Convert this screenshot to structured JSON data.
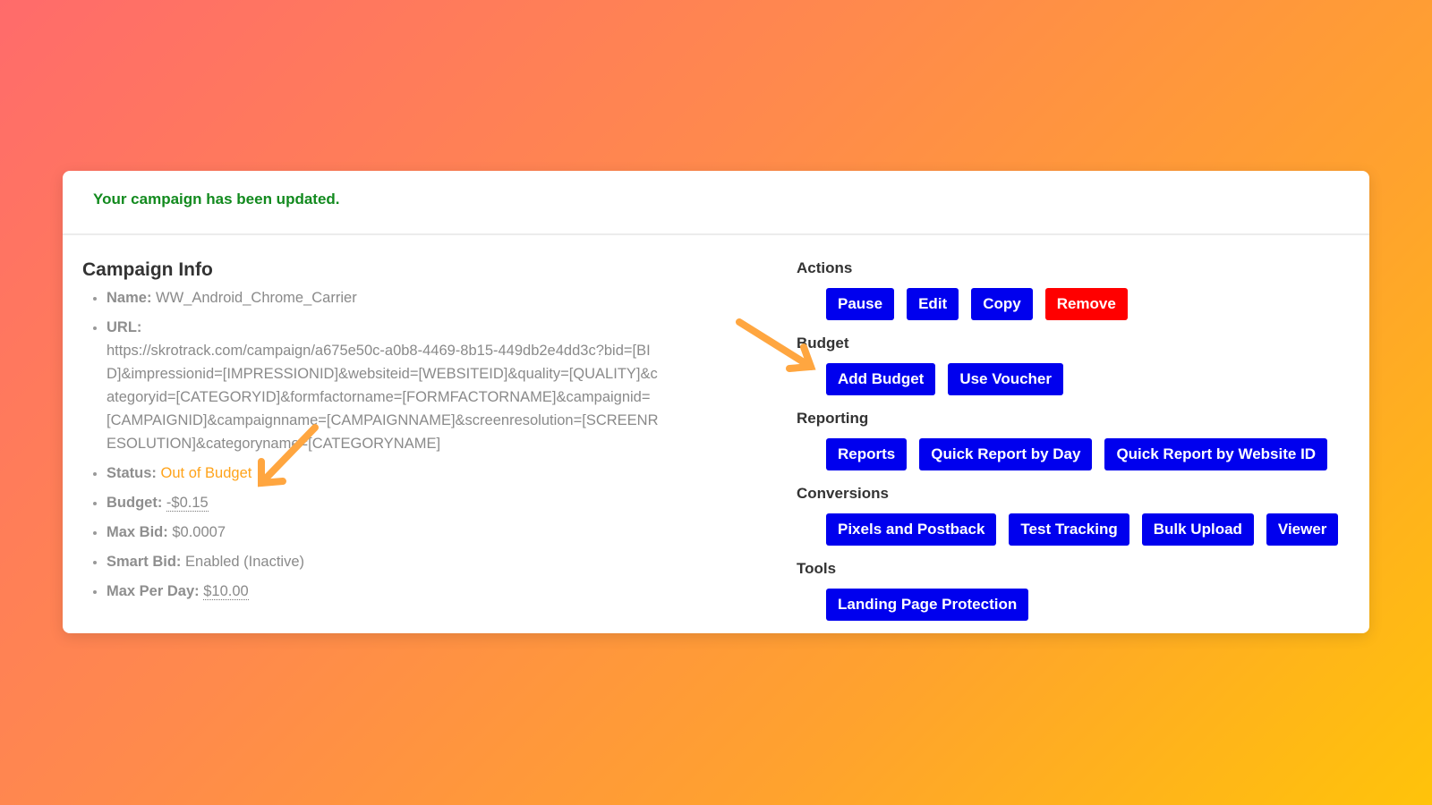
{
  "alert": {
    "message": "Your campaign has been updated.",
    "color": "#128a1e"
  },
  "campaign_info": {
    "title": "Campaign Info",
    "name_label": "Name:",
    "name_value": "WW_Android_Chrome_Carrier",
    "url_label": "URL:",
    "url_value": "https://skrotrack.com/campaign/a675e50c-a0b8-4469-8b15-449db2e4dd3c?bid=[BID]&impressionid=[IMPRESSIONID]&websiteid=[WEBSITEID]&quality=[QUALITY]&categoryid=[CATEGORYID]&formfactorname=[FORMFACTORNAME]&campaignid=[CAMPAIGNID]&campaignname=[CAMPAIGNNAME]&screenresolution=[SCREENRESOLUTION]&categoryname=[CATEGORYNAME]",
    "status_label": "Status:",
    "status_value": "Out of Budget",
    "status_color": "#ffa31a",
    "budget_label": "Budget:",
    "budget_value": "-$0.15",
    "maxbid_label": "Max Bid:",
    "maxbid_value": "$0.0007",
    "smartbid_label": "Smart Bid:",
    "smartbid_value": "Enabled (Inactive)",
    "maxperday_label": "Max Per Day:",
    "maxperday_value": "$10.00"
  },
  "sections": {
    "actions": {
      "title": "Actions",
      "buttons": [
        "Pause",
        "Edit",
        "Copy",
        "Remove"
      ]
    },
    "budget": {
      "title": "Budget",
      "buttons": [
        "Add Budget",
        "Use Voucher"
      ]
    },
    "reporting": {
      "title": "Reporting",
      "buttons": [
        "Reports",
        "Quick Report by Day",
        "Quick Report by Website ID"
      ]
    },
    "conversions": {
      "title": "Conversions",
      "buttons": [
        "Pixels and Postback",
        "Test Tracking",
        "Bulk Upload",
        "Viewer"
      ]
    },
    "tools": {
      "title": "Tools",
      "buttons": [
        "Landing Page Protection"
      ]
    }
  },
  "colors": {
    "button_primary": "#0000ee",
    "button_danger": "#ff0000",
    "annotation_arrow": "#ffa640"
  }
}
